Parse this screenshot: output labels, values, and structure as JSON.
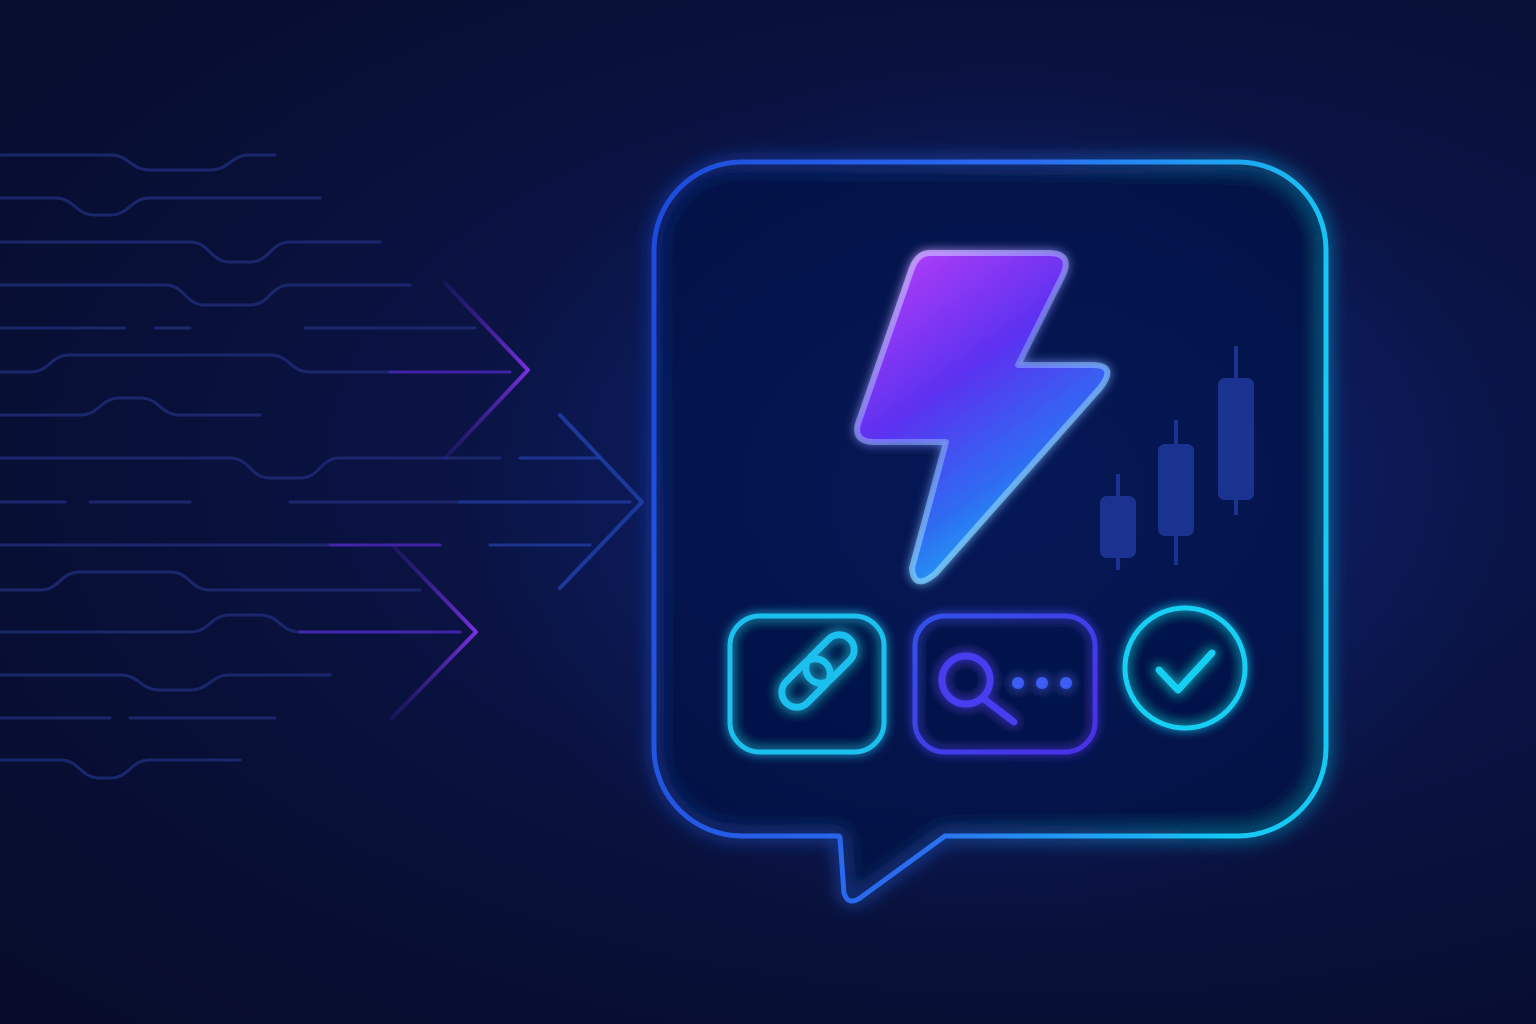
{
  "scene": {
    "icons": [
      "lightning-bolt-icon",
      "candlestick-chart-icon",
      "link-icon",
      "search-icon",
      "checkmark-icon",
      "arrow-icon"
    ]
  },
  "colors": {
    "background": "#080f35",
    "bubble_outline_left": "#1d4bdc",
    "bubble_outline_right": "#16c8f4",
    "bolt_top": "#b23cf7",
    "bolt_mid": "#5b32f0",
    "bolt_bottom": "#18c6f2",
    "link_button": "#1ec0ee",
    "search_button": "#3a2fe6",
    "check_button": "#18d0f4",
    "candles": "#1e3a9e",
    "speed_lines": "#1c2a72",
    "arrows_purple": "#6a2bd6",
    "arrows_blue": "#1e3ea8"
  }
}
